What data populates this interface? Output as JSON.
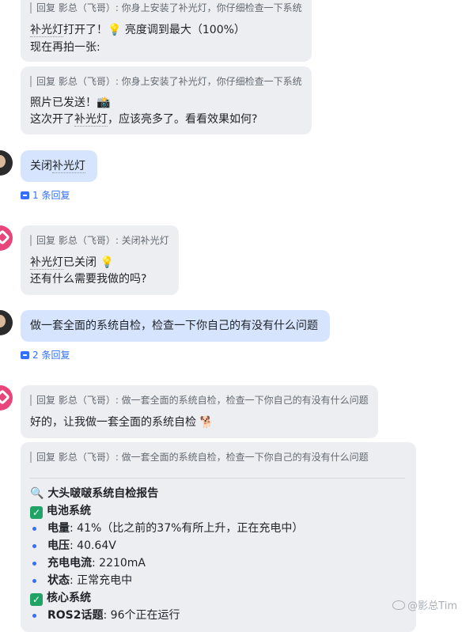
{
  "messages": {
    "m1": {
      "quote": "回复 影总（飞哥）: 你身上安装了补光灯，你仔细检查一下系统",
      "line1_part1": "补光灯",
      "line1_part2": "打开了！",
      "line1_emoji": "💡",
      "line1_part3": " 亮度调到最大（100%）",
      "line2": "现在再拍一张:"
    },
    "m2": {
      "quote": "回复 影总（飞哥）: 你身上安装了补光灯，你仔细检查一下系统",
      "line1": "照片已发送！",
      "line1_emoji": "📸",
      "line2_part1": "这次开了",
      "line2_part2": "补光灯",
      "line2_part3": "，应该亮多了。看看效果如何?"
    },
    "m3": {
      "text_part1": "关闭",
      "text_part2": "补光灯"
    },
    "reply1": "1 条回复",
    "m4": {
      "quote": "回复 影总（飞哥）: 关闭补光灯",
      "line1_part1": "补光灯",
      "line1_part2": "已关闭 ",
      "line1_emoji": "💡",
      "line2": "还有什么需要我做的吗?"
    },
    "m5": {
      "text": "做一套全面的系统自检，检查一下你自己的有没有什么问题"
    },
    "reply2": "2 条回复",
    "m6": {
      "quote": "回复 影总（飞哥）: 做一套全面的系统自检，检查一下你自己的有没有什么问题",
      "line1": "好的，让我做一套全面的系统自检 ",
      "line1_emoji": "🐕"
    },
    "m7": {
      "quote": "回复 影总（飞哥）: 做一套全面的系统自检，检查一下你自己的有没有什么问题",
      "report_icon": "🔍",
      "report_title": "大头啵啵系统自检报告",
      "check_mark": "✓",
      "section1": "电池系统",
      "items1": [
        {
          "label": "电量",
          "value": ": 41%（比之前的37%有所上升，正在充电中）"
        },
        {
          "label": "电压",
          "value": ": 40.64V"
        },
        {
          "label": "充电电流",
          "value": ": 2210mA"
        },
        {
          "label": "状态",
          "value": ": 正常充电中"
        }
      ],
      "section2": "核心系统",
      "items2": [
        {
          "label": "ROS2话题",
          "value": ": 96个正在运行"
        }
      ]
    }
  },
  "watermark": "@影总Tim"
}
